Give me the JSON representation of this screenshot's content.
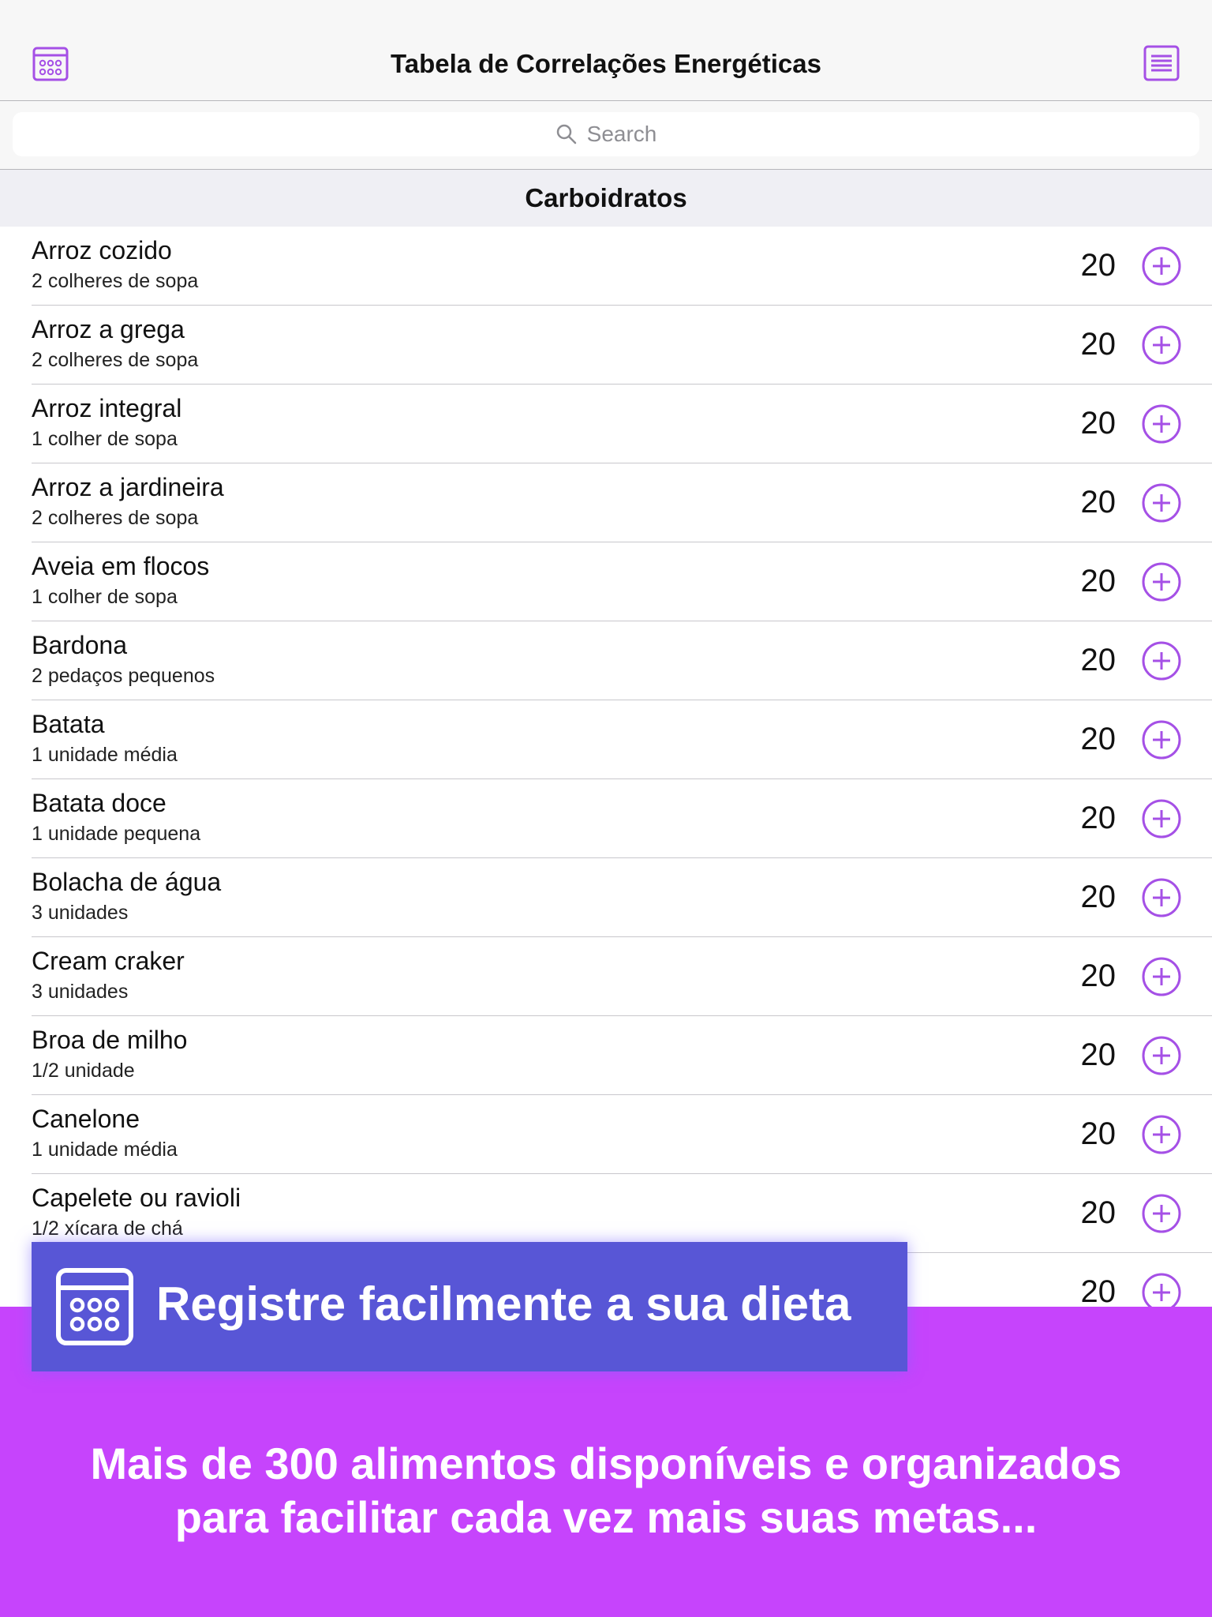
{
  "nav": {
    "title": "Tabela de Correlações Energéticas",
    "left_icon": "calendar-grid-icon",
    "right_icon": "list-icon"
  },
  "search": {
    "placeholder": "Search"
  },
  "section": {
    "title": "Carboidratos"
  },
  "foods": [
    {
      "name": "Arroz cozido",
      "portion": "2 colheres de sopa",
      "value": "20"
    },
    {
      "name": "Arroz a grega",
      "portion": "2 colheres de sopa",
      "value": "20"
    },
    {
      "name": "Arroz integral",
      "portion": "1 colher de sopa",
      "value": "20"
    },
    {
      "name": "Arroz a jardineira",
      "portion": "2 colheres de sopa",
      "value": "20"
    },
    {
      "name": "Aveia em flocos",
      "portion": "1 colher de sopa",
      "value": "20"
    },
    {
      "name": "Bardona",
      "portion": "2 pedaços pequenos",
      "value": "20"
    },
    {
      "name": "Batata",
      "portion": "1 unidade média",
      "value": "20"
    },
    {
      "name": "Batata doce",
      "portion": "1 unidade pequena",
      "value": "20"
    },
    {
      "name": "Bolacha de água",
      "portion": "3 unidades",
      "value": "20"
    },
    {
      "name": "Cream craker",
      "portion": "3 unidades",
      "value": "20"
    },
    {
      "name": "Broa de milho",
      "portion": "1/2 unidade",
      "value": "20"
    },
    {
      "name": "Canelone",
      "portion": "1 unidade média",
      "value": "20"
    },
    {
      "name": "Capelete ou ravioli",
      "portion": "1/2 xícara de chá",
      "value": "20"
    },
    {
      "name": "",
      "portion": "",
      "value": "20"
    }
  ],
  "banner": {
    "feature": "Registre facilmente a sua dieta",
    "line1": "Mais de 300 alimentos disponíveis e organizados",
    "line2": "para facilitar cada vez mais suas metas..."
  },
  "colors": {
    "accent": "#a550e6",
    "banner": "#c644fc",
    "feature_box": "#5856d6"
  }
}
